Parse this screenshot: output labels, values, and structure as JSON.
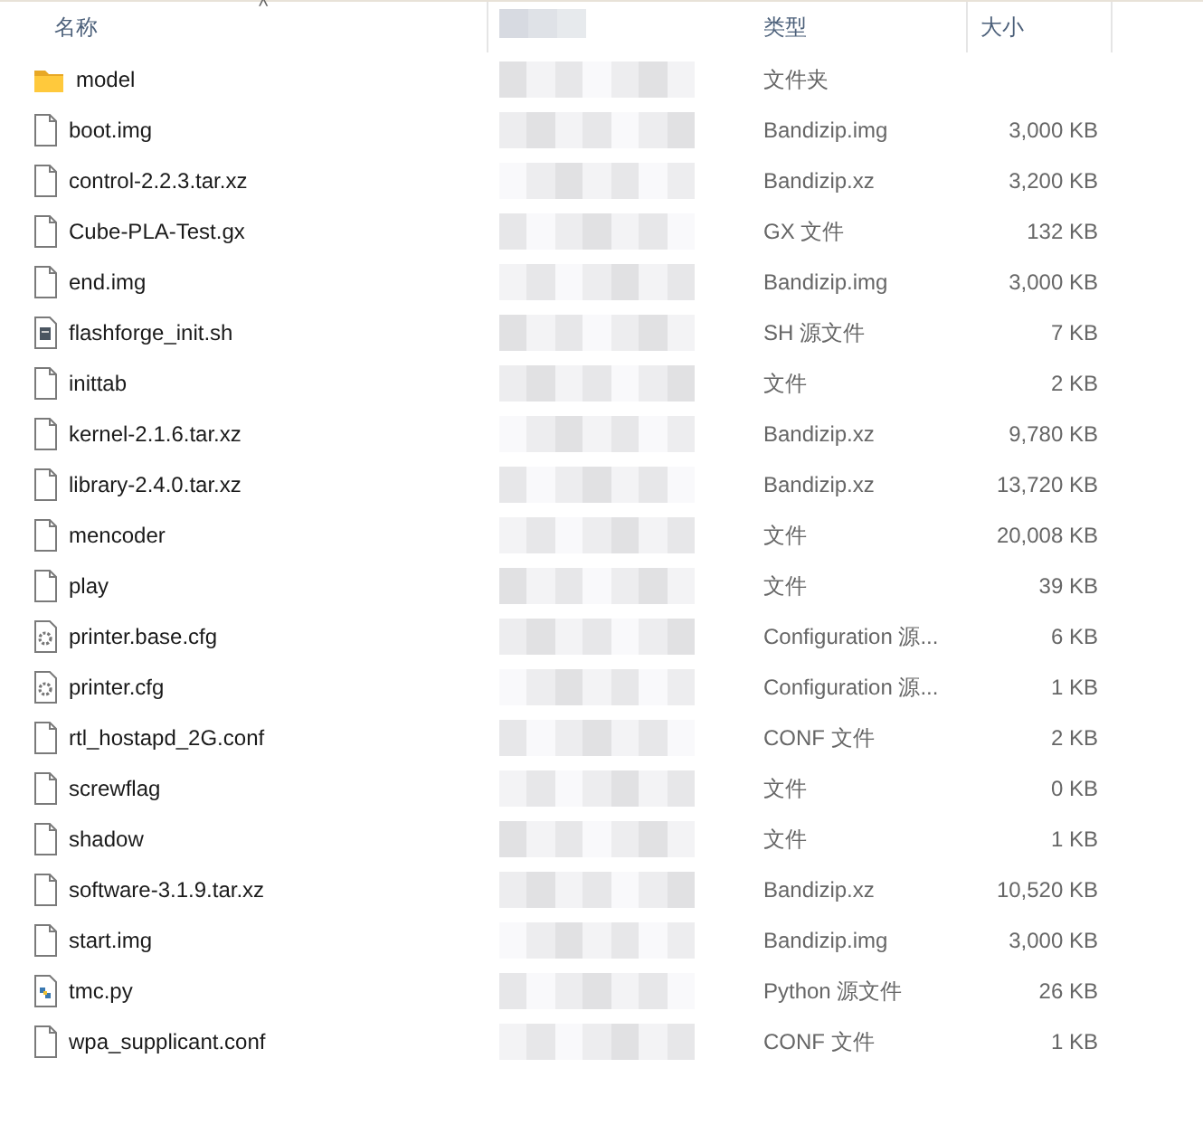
{
  "header": {
    "sort_indicator": "^",
    "columns": [
      {
        "label": "名称",
        "kind": "text"
      },
      {
        "kind": "blurred"
      },
      {
        "label": "类型",
        "kind": "text"
      },
      {
        "label": "大小",
        "kind": "text"
      }
    ]
  },
  "files": [
    {
      "name": "model",
      "kind": "folder",
      "date_blurred": true,
      "type": "文件夹"
    },
    {
      "name": "boot.img",
      "kind": "file",
      "date_blurred": true,
      "type": "Bandizip.img",
      "size": "3,000 KB"
    },
    {
      "name": "control-2.2.3.tar.xz",
      "kind": "file",
      "date_blurred": true,
      "type": "Bandizip.xz",
      "size": "3,200 KB"
    },
    {
      "name": "Cube-PLA-Test.gx",
      "kind": "file",
      "date_blurred": true,
      "type": "GX 文件",
      "size": "132 KB"
    },
    {
      "name": "end.img",
      "kind": "file",
      "date_blurred": true,
      "type": "Bandizip.img",
      "size": "3,000 KB"
    },
    {
      "name": "flashforge_init.sh",
      "kind": "script",
      "date_blurred": true,
      "type": "SH 源文件",
      "size": "7 KB"
    },
    {
      "name": "inittab",
      "kind": "file",
      "date_blurred": true,
      "type": "文件",
      "size": "2 KB"
    },
    {
      "name": "kernel-2.1.6.tar.xz",
      "kind": "file",
      "date_blurred": true,
      "type": "Bandizip.xz",
      "size": "9,780 KB"
    },
    {
      "name": "library-2.4.0.tar.xz",
      "kind": "file",
      "date_blurred": true,
      "type": "Bandizip.xz",
      "size": "13,720 KB"
    },
    {
      "name": "mencoder",
      "kind": "file",
      "date_blurred": true,
      "type": "文件",
      "size": "20,008 KB"
    },
    {
      "name": "play",
      "kind": "file",
      "date_blurred": true,
      "type": "文件",
      "size": "39 KB"
    },
    {
      "name": "printer.base.cfg",
      "kind": "settings",
      "date_blurred": true,
      "type": "Configuration 源...",
      "size": "6 KB"
    },
    {
      "name": "printer.cfg",
      "kind": "settings",
      "date_blurred": true,
      "type": "Configuration 源...",
      "size": "1 KB"
    },
    {
      "name": "rtl_hostapd_2G.conf",
      "kind": "file",
      "date_blurred": true,
      "type": "CONF 文件",
      "size": "2 KB"
    },
    {
      "name": "screwflag",
      "kind": "file",
      "date_blurred": true,
      "type": "文件",
      "size": "0 KB"
    },
    {
      "name": "shadow",
      "kind": "file",
      "date_blurred": true,
      "type": "文件",
      "size": "1 KB"
    },
    {
      "name": "software-3.1.9.tar.xz",
      "kind": "file",
      "date_blurred": true,
      "type": "Bandizip.xz",
      "size": "10,520 KB"
    },
    {
      "name": "start.img",
      "kind": "file",
      "date_blurred": true,
      "type": "Bandizip.img",
      "size": "3,000 KB"
    },
    {
      "name": "tmc.py",
      "kind": "python",
      "date_blurred": true,
      "type": "Python 源文件",
      "size": "26 KB"
    },
    {
      "name": "wpa_supplicant.conf",
      "kind": "file",
      "date_blurred": true,
      "type": "CONF 文件",
      "size": "1 KB"
    }
  ]
}
